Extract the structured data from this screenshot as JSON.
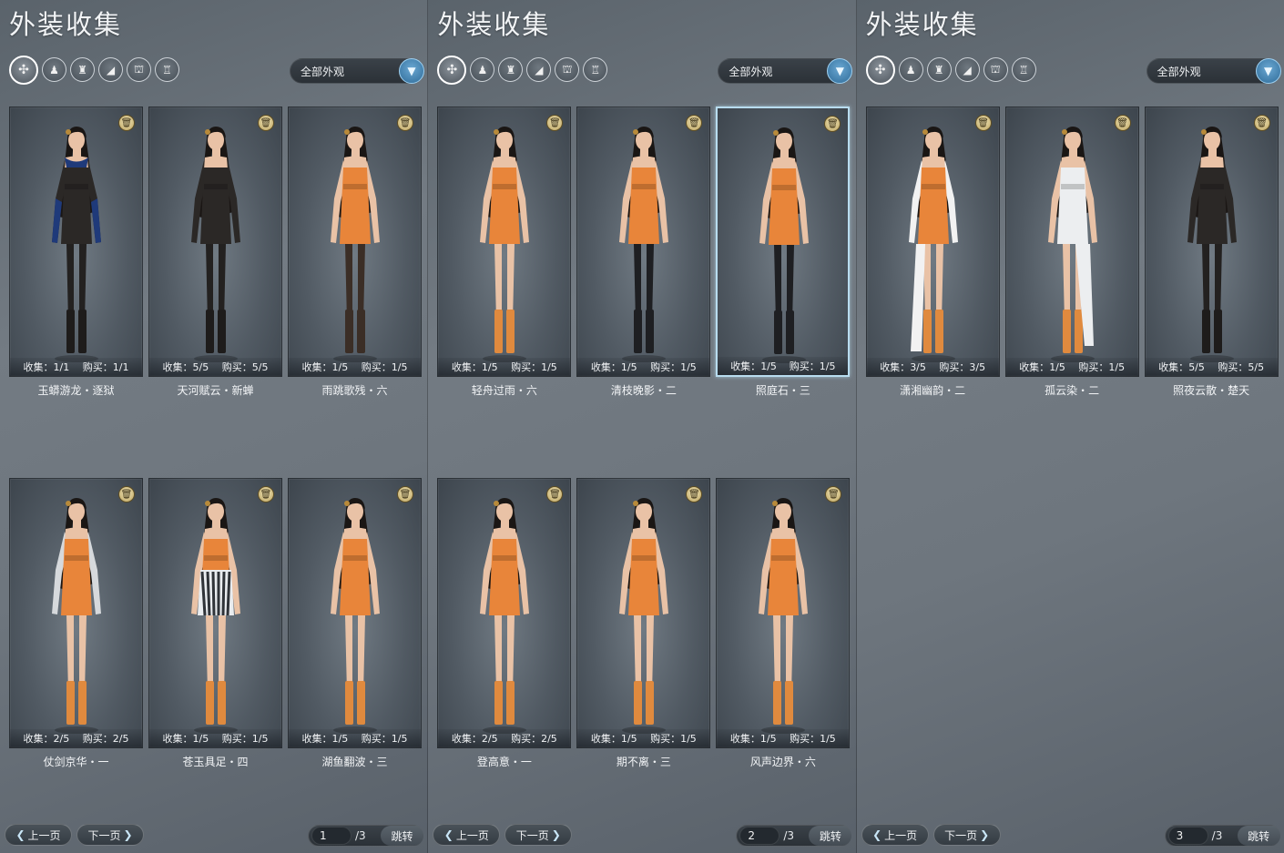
{
  "panels": [
    {
      "title": "外装收集",
      "filter_label": "全部外观",
      "items": [
        {
          "collect": "1/1",
          "buy": "1/1",
          "name": "玉蟒游龙・逐狱",
          "outfit": "dark",
          "accent": "#1f3a7a",
          "selected": false
        },
        {
          "collect": "5/5",
          "buy": "5/5",
          "name": "天河赋云・新蝉",
          "outfit": "dark",
          "accent": "#2a2420",
          "selected": false
        },
        {
          "collect": "1/5",
          "buy": "1/5",
          "name": "雨跳歌残・六",
          "outfit": "orange",
          "accent": "#3b2e26",
          "selected": false
        },
        {
          "collect": "2/5",
          "buy": "2/5",
          "name": "仗剑京华・一",
          "outfit": "orange",
          "accent": "#d6d9dc",
          "selected": false
        },
        {
          "collect": "1/5",
          "buy": "1/5",
          "name": "苍玉具足・四",
          "outfit": "stripe",
          "accent": "#e8853a",
          "selected": false
        },
        {
          "collect": "1/5",
          "buy": "1/5",
          "name": "湖鱼翻波・三",
          "outfit": "orange",
          "accent": "#e8853a",
          "selected": false
        }
      ],
      "pager": {
        "prev": "上一页",
        "next": "下一页",
        "page": "1",
        "total": "/3",
        "jump": "跳转"
      }
    },
    {
      "title": "外装收集",
      "filter_label": "全部外观",
      "items": [
        {
          "collect": "1/5",
          "buy": "1/5",
          "name": "轻舟过雨・六",
          "outfit": "orange",
          "accent": "#e8853a",
          "selected": false
        },
        {
          "collect": "1/5",
          "buy": "1/5",
          "name": "清枝晚影・二",
          "outfit": "orange",
          "accent": "#1e1f22",
          "selected": false
        },
        {
          "collect": "1/5",
          "buy": "1/5",
          "name": "照庭石・三",
          "outfit": "orange",
          "accent": "#1e1f22",
          "selected": true
        },
        {
          "collect": "2/5",
          "buy": "2/5",
          "name": "登高意・一",
          "outfit": "orange",
          "accent": "#e8853a",
          "selected": false
        },
        {
          "collect": "1/5",
          "buy": "1/5",
          "name": "期不离・三",
          "outfit": "orange",
          "accent": "#e8853a",
          "selected": false
        },
        {
          "collect": "1/5",
          "buy": "1/5",
          "name": "风声边界・六",
          "outfit": "orange",
          "accent": "#e8853a",
          "selected": false
        }
      ],
      "pager": {
        "prev": "上一页",
        "next": "下一页",
        "page": "2",
        "total": "/3",
        "jump": "跳转"
      }
    },
    {
      "title": "外装收集",
      "filter_label": "全部外观",
      "items": [
        {
          "collect": "3/5",
          "buy": "3/5",
          "name": "潇湘幽韵・二",
          "outfit": "orange",
          "accent": "#f2f2f2",
          "selected": false
        },
        {
          "collect": "1/5",
          "buy": "1/5",
          "name": "孤云染・二",
          "outfit": "white",
          "accent": "#e8853a",
          "selected": false
        },
        {
          "collect": "5/5",
          "buy": "5/5",
          "name": "照夜云散・楚天",
          "outfit": "dark",
          "accent": "#2a2a2a",
          "selected": false
        }
      ],
      "pager": {
        "prev": "上一页",
        "next": "下一页",
        "page": "3",
        "total": "/3",
        "jump": "跳转"
      }
    }
  ],
  "labels": {
    "collect": "收集：",
    "buy": "购买："
  },
  "category_icons": [
    "full-outfit-icon",
    "top-icon",
    "bottom-icon",
    "shoes-icon",
    "accessory-icon",
    "hat-icon"
  ],
  "category_glyphs": [
    "✣",
    "♟",
    "♜",
    "◢",
    "⛫",
    "♖"
  ],
  "icons": {
    "delete": "trash-icon",
    "dropdown": "chevron-down-icon"
  },
  "colors": {
    "selected_border": "#b8dcef",
    "dropdown_button": "#3f85b8",
    "skin": "#e9c2a6",
    "hair": "#1a1614"
  }
}
